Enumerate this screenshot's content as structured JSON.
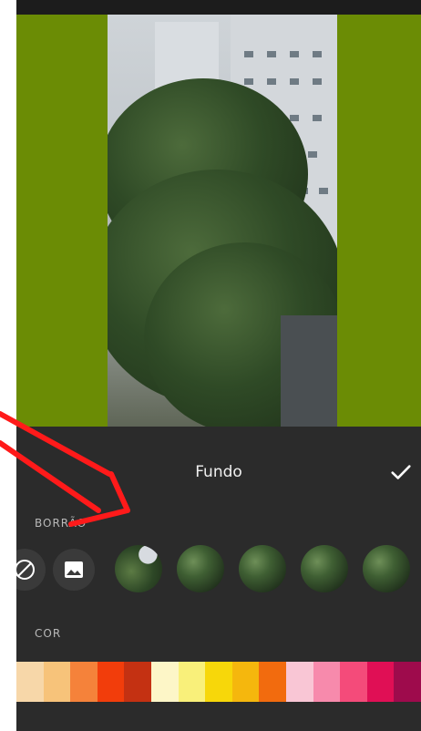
{
  "sheet": {
    "title": "Fundo",
    "sections": {
      "blur_label": "BORRÃO",
      "color_label": "COR"
    },
    "icons": {
      "confirm": "checkmark-icon",
      "none": "no-background-icon",
      "gallery": "image-gallery-icon"
    }
  },
  "colors": [
    "#f7d7a9",
    "#f7c37a",
    "#f5823a",
    "#f23d0b",
    "#c43112",
    "#fdf6c7",
    "#f9f07a",
    "#f7d70a",
    "#f5b70d",
    "#f26b0e",
    "#f9c6d5",
    "#f78aac",
    "#f44b7a",
    "#e00f55",
    "#9e0b4c"
  ],
  "accent": "#ff1a1a"
}
